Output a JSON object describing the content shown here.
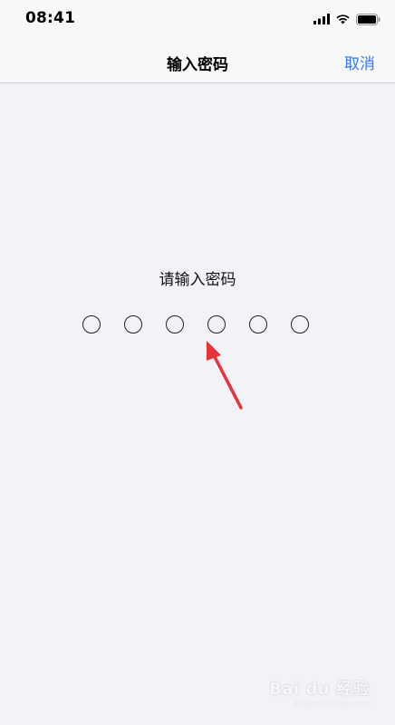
{
  "status_bar": {
    "time": "08:41"
  },
  "nav": {
    "title": "输入密码",
    "cancel_label": "取消"
  },
  "content": {
    "prompt": "请输入密码",
    "passcode_slots": 6,
    "filled": 0
  },
  "watermark": {
    "brand": "Bai du 经验",
    "sub": "jingyan.baidu.com"
  },
  "colors": {
    "accent": "#3478f6",
    "background": "#f2f2f7",
    "annotation_arrow": "#e8323a"
  },
  "icons": [
    "cellular-signal-icon",
    "wifi-icon",
    "battery-icon",
    "annotation-arrow-icon"
  ]
}
